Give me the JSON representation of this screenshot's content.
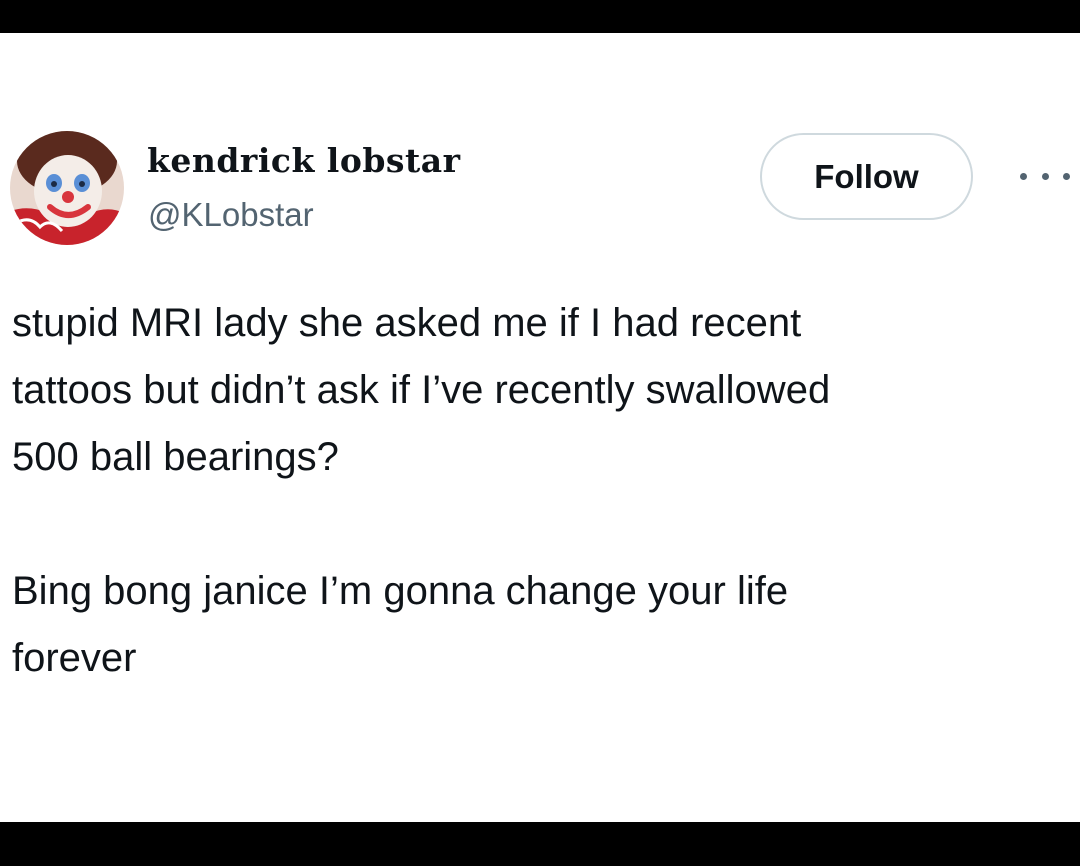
{
  "author": {
    "display_name": "kendrick lobstar",
    "handle": "@KLobstar",
    "avatar_icon": "clown-avatar"
  },
  "actions": {
    "follow_label": "Follow",
    "more_icon": "more-options-icon"
  },
  "tweet": {
    "paragraph_1": "stupid MRI lady she asked me if I had recent\ntattoos but didn’t ask if I’ve recently swallowed\n500 ball bearings?",
    "paragraph_2": "Bing bong janice I’m gonna change your life\nforever"
  },
  "colors": {
    "text_primary": "#0f1419",
    "text_secondary": "#536471",
    "border": "#cfd9de",
    "background": "#ffffff",
    "letterbox": "#000000"
  }
}
